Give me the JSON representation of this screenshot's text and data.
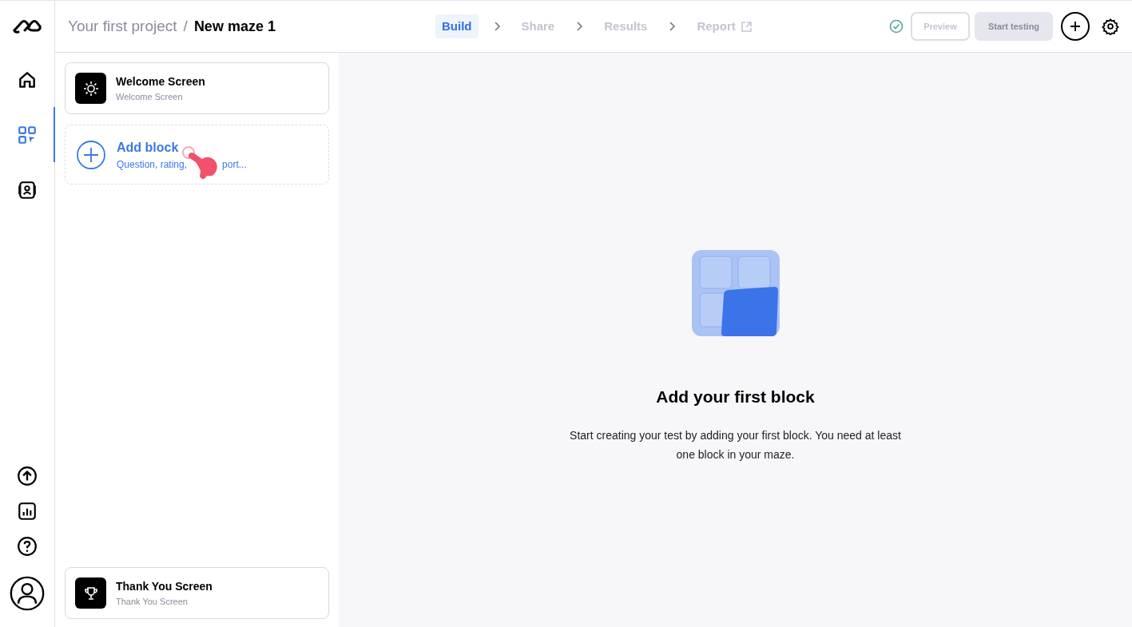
{
  "breadcrumb": {
    "project": "Your first project",
    "separator": "/",
    "title": "New maze 1"
  },
  "steps": [
    {
      "label": "Build",
      "selected": true,
      "external": false
    },
    {
      "label": "Share",
      "selected": false,
      "external": false
    },
    {
      "label": "Results",
      "selected": false,
      "external": false
    },
    {
      "label": "Report",
      "selected": false,
      "external": true
    }
  ],
  "header_buttons": [
    {
      "label": "Preview",
      "kind": "outline",
      "disabled": true
    },
    {
      "label": "Start testing",
      "kind": "filled",
      "disabled": true
    }
  ],
  "rail_top": [
    {
      "kind": "home",
      "selected": false
    },
    {
      "kind": "build",
      "selected": true
    },
    {
      "kind": "participants",
      "selected": false
    }
  ],
  "rail_bottom": [
    {
      "kind": "upload"
    },
    {
      "kind": "chart"
    },
    {
      "kind": "help"
    },
    {
      "kind": "avatar"
    }
  ],
  "blocks": {
    "welcome": {
      "title": "Welcome Screen",
      "subtitle": "Welcome Screen"
    },
    "add": {
      "title": "Add block",
      "subtitle_start": "Question, rating,",
      "subtitle_end": "port..."
    },
    "thank_you": {
      "title": "Thank You Screen",
      "subtitle": "Thank You Screen"
    }
  },
  "empty_state": {
    "title": "Add your first block",
    "text": "Start creating your test by adding your first block. You need at least one block in your maze."
  }
}
